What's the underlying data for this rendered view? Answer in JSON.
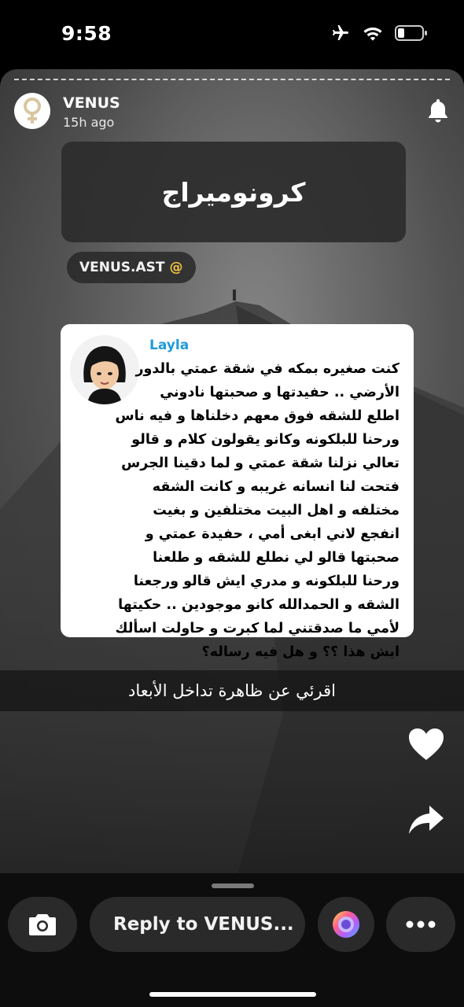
{
  "status_bar": {
    "time": "9:58"
  },
  "story": {
    "username": "VENUS",
    "time_ago": "15h ago",
    "title": "كرونوميراج",
    "handle": "VENUS.AST",
    "handle_symbol": "@",
    "message": {
      "sender": "Layla",
      "lines": [
        "كنت صغيره بمكه في شقة عمتي بالدور",
        "الأرضي .. حفيدتها و صحبتها نادوني",
        "اطلع للشقه فوق معهم دخلناها و فيه ناس",
        "ورحنا للبلكونه وكانو يقولون كلام و قالو",
        "تعالي نزلنا شقة عمتي و لما دقينا الجرس",
        "فتحت لنا انسانه غريبه و كانت الشقه",
        "مختلفه و اهل البيت مختلفين و بغيت",
        "انفجع لاني ابغى أمي ، حفيدة عمتي و",
        "صحبتها قالو لي نطلع للشقه و طلعنا",
        "ورحنا للبلكونه و مدري ايش قالو ورجعنا",
        "الشقه و الحمدالله كانو موجودين .. حكيتها",
        "لأمي ما صدقتني لما كبرت و حاولت اسألك",
        "ايش هذا ؟؟ و هل فيه رساله؟"
      ]
    },
    "caption": "اقرئي عن ظاهرة تداخل الأبعاد"
  },
  "reply": {
    "placeholder": "Reply to VENUS..."
  },
  "icons": {
    "airplane": "airplane-icon",
    "wifi": "wifi-icon",
    "battery": "battery-icon",
    "bell": "bell-icon",
    "heart": "heart-icon",
    "share": "share-icon",
    "camera": "camera-icon",
    "lens": "lens-icon",
    "more": "more-icon"
  },
  "colors": {
    "sender_name": "#1f9bdc",
    "handle_at": "#f7c843"
  }
}
